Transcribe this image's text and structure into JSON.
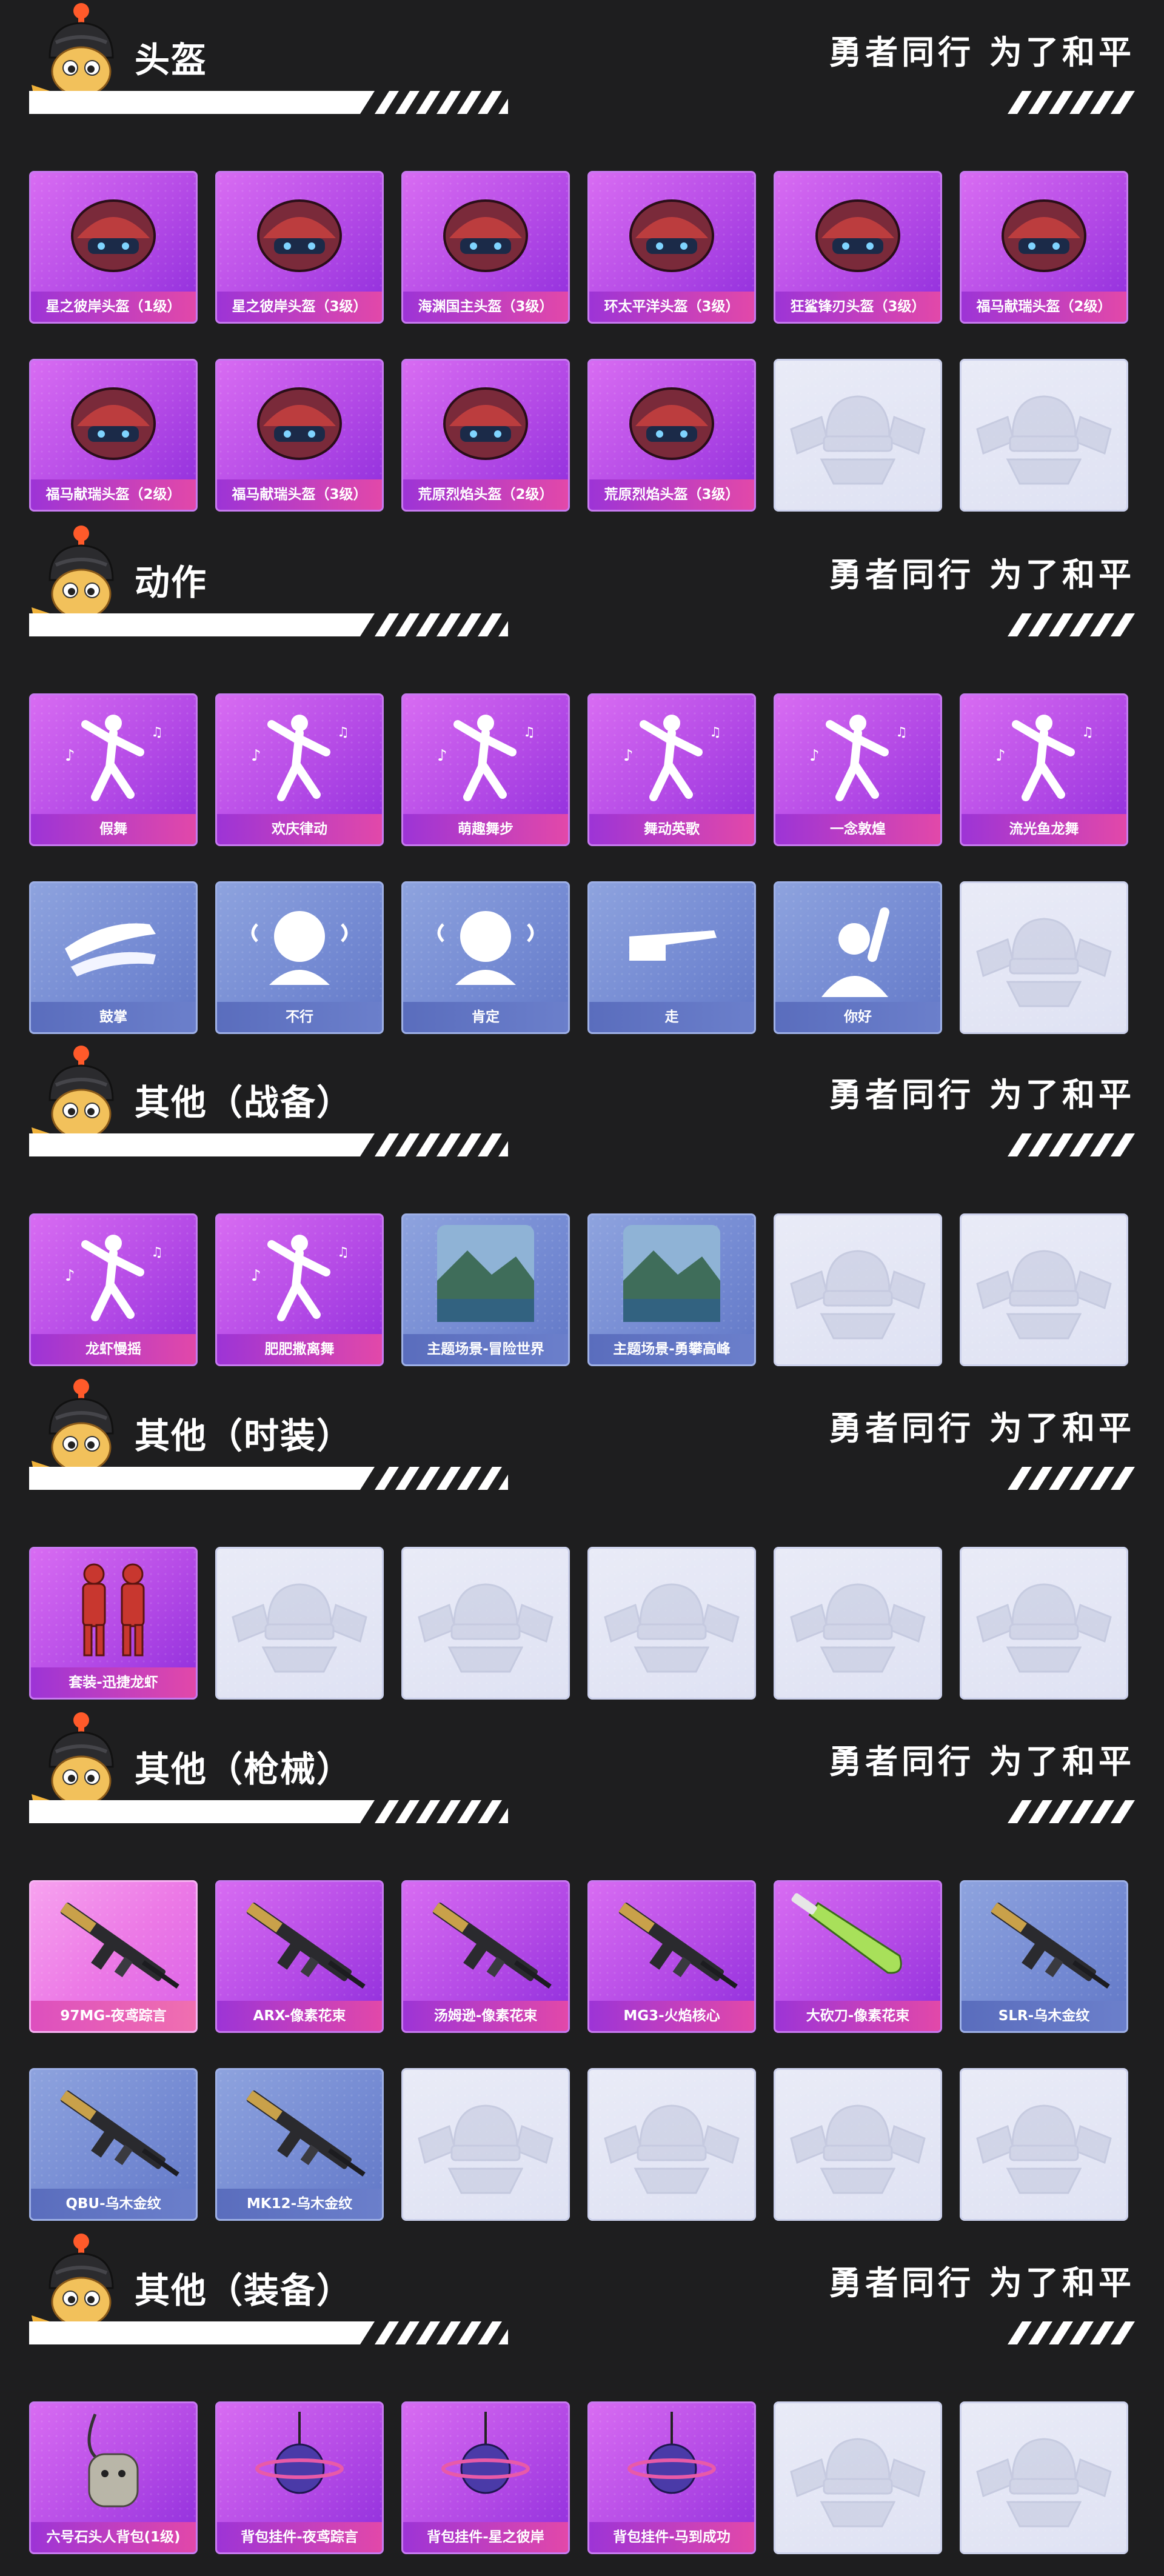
{
  "slogan": "勇者同行 为了和平",
  "sections": [
    {
      "title": "头盔",
      "cards": [
        {
          "label": "星之彼岸头盔（1级）",
          "theme": "purple",
          "icon": "helmet-icon"
        },
        {
          "label": "星之彼岸头盔（3级）",
          "theme": "purple",
          "icon": "helmet-icon"
        },
        {
          "label": "海渊国主头盔（3级）",
          "theme": "purple",
          "icon": "helmet-icon"
        },
        {
          "label": "环太平洋头盔（3级）",
          "theme": "purple",
          "icon": "helmet-icon"
        },
        {
          "label": "狂鲨锋刃头盔（3级）",
          "theme": "purple",
          "icon": "helmet-icon"
        },
        {
          "label": "福马献瑞头盔（2级）",
          "theme": "purple",
          "icon": "helmet-icon"
        },
        {
          "label": "福马献瑞头盔（2级）",
          "theme": "purple",
          "icon": "helmet-icon"
        },
        {
          "label": "福马献瑞头盔（3级）",
          "theme": "purple",
          "icon": "helmet-icon"
        },
        {
          "label": "荒原烈焰头盔（2级）",
          "theme": "purple",
          "icon": "helmet-icon"
        },
        {
          "label": "荒原烈焰头盔（3级）",
          "theme": "purple",
          "icon": "helmet-icon"
        },
        {
          "label": "",
          "theme": "empty",
          "icon": "placeholder-emblem-icon"
        },
        {
          "label": "",
          "theme": "empty",
          "icon": "placeholder-emblem-icon"
        }
      ]
    },
    {
      "title": "动作",
      "cards": [
        {
          "label": "假舞",
          "theme": "purple",
          "icon": "dance-icon"
        },
        {
          "label": "欢庆律动",
          "theme": "purple",
          "icon": "dance-icon"
        },
        {
          "label": "萌趣舞步",
          "theme": "purple",
          "icon": "dance-icon"
        },
        {
          "label": "舞动英歌",
          "theme": "purple",
          "icon": "dance-icon"
        },
        {
          "label": "一念敦煌",
          "theme": "purple",
          "icon": "dance-icon"
        },
        {
          "label": "流光鱼龙舞",
          "theme": "purple",
          "icon": "dance-icon"
        },
        {
          "label": "鼓掌",
          "theme": "blue",
          "icon": "clap-icon"
        },
        {
          "label": "不行",
          "theme": "blue",
          "icon": "head-shake-icon"
        },
        {
          "label": "肯定",
          "theme": "blue",
          "icon": "nod-icon"
        },
        {
          "label": "走",
          "theme": "blue",
          "icon": "point-icon"
        },
        {
          "label": "你好",
          "theme": "blue",
          "icon": "wave-icon"
        },
        {
          "label": "",
          "theme": "empty",
          "icon": "placeholder-emblem-icon"
        }
      ]
    },
    {
      "title": "其他（战备）",
      "cards": [
        {
          "label": "龙虾慢摇",
          "theme": "purple",
          "icon": "dance-icon"
        },
        {
          "label": "肥肥撒离舞",
          "theme": "purple",
          "icon": "dance-icon"
        },
        {
          "label": "主题场景-冒险世界",
          "theme": "blue",
          "icon": "scene-icon"
        },
        {
          "label": "主题场景-勇攀高峰",
          "theme": "blue",
          "icon": "scene-icon"
        },
        {
          "label": "",
          "theme": "empty",
          "icon": "placeholder-emblem-icon"
        },
        {
          "label": "",
          "theme": "empty",
          "icon": "placeholder-emblem-icon"
        }
      ]
    },
    {
      "title": "其他（时装）",
      "cards": [
        {
          "label": "套装-迅捷龙虾",
          "theme": "purple",
          "icon": "outfit-icon"
        },
        {
          "label": "",
          "theme": "empty",
          "icon": "placeholder-emblem-icon"
        },
        {
          "label": "",
          "theme": "empty",
          "icon": "placeholder-emblem-icon"
        },
        {
          "label": "",
          "theme": "empty",
          "icon": "placeholder-emblem-icon"
        },
        {
          "label": "",
          "theme": "empty",
          "icon": "placeholder-emblem-icon"
        },
        {
          "label": "",
          "theme": "empty",
          "icon": "placeholder-emblem-icon"
        }
      ]
    },
    {
      "title": "其他（枪械）",
      "cards": [
        {
          "label": "97MG-夜鸢踪言",
          "theme": "pink",
          "icon": "gun-icon"
        },
        {
          "label": "ARX-像素花束",
          "theme": "purple",
          "icon": "gun-icon"
        },
        {
          "label": "汤姆逊-像素花束",
          "theme": "purple",
          "icon": "gun-icon"
        },
        {
          "label": "MG3-火焰核心",
          "theme": "purple",
          "icon": "gun-icon"
        },
        {
          "label": "大砍刀-像素花束",
          "theme": "purple",
          "icon": "machete-icon"
        },
        {
          "label": "SLR-乌木金纹",
          "theme": "blue",
          "icon": "gun-icon"
        },
        {
          "label": "QBU-乌木金纹",
          "theme": "blue",
          "icon": "gun-icon"
        },
        {
          "label": "MK12-乌木金纹",
          "theme": "blue",
          "icon": "gun-icon"
        },
        {
          "label": "",
          "theme": "empty",
          "icon": "placeholder-emblem-icon"
        },
        {
          "label": "",
          "theme": "empty",
          "icon": "placeholder-emblem-icon"
        },
        {
          "label": "",
          "theme": "empty",
          "icon": "placeholder-emblem-icon"
        },
        {
          "label": "",
          "theme": "empty",
          "icon": "placeholder-emblem-icon"
        }
      ]
    },
    {
      "title": "其他（装备）",
      "cards": [
        {
          "label": "六号石头人背包(1级)",
          "theme": "purple",
          "icon": "backpack-icon"
        },
        {
          "label": "背包挂件-夜鸢踪言",
          "theme": "purple",
          "icon": "pendant-icon"
        },
        {
          "label": "背包挂件-星之彼岸",
          "theme": "purple",
          "icon": "pendant-icon"
        },
        {
          "label": "背包挂件-马到成功",
          "theme": "purple",
          "icon": "pendant-icon"
        },
        {
          "label": "",
          "theme": "empty",
          "icon": "placeholder-emblem-icon"
        },
        {
          "label": "",
          "theme": "empty",
          "icon": "placeholder-emblem-icon"
        }
      ]
    }
  ]
}
